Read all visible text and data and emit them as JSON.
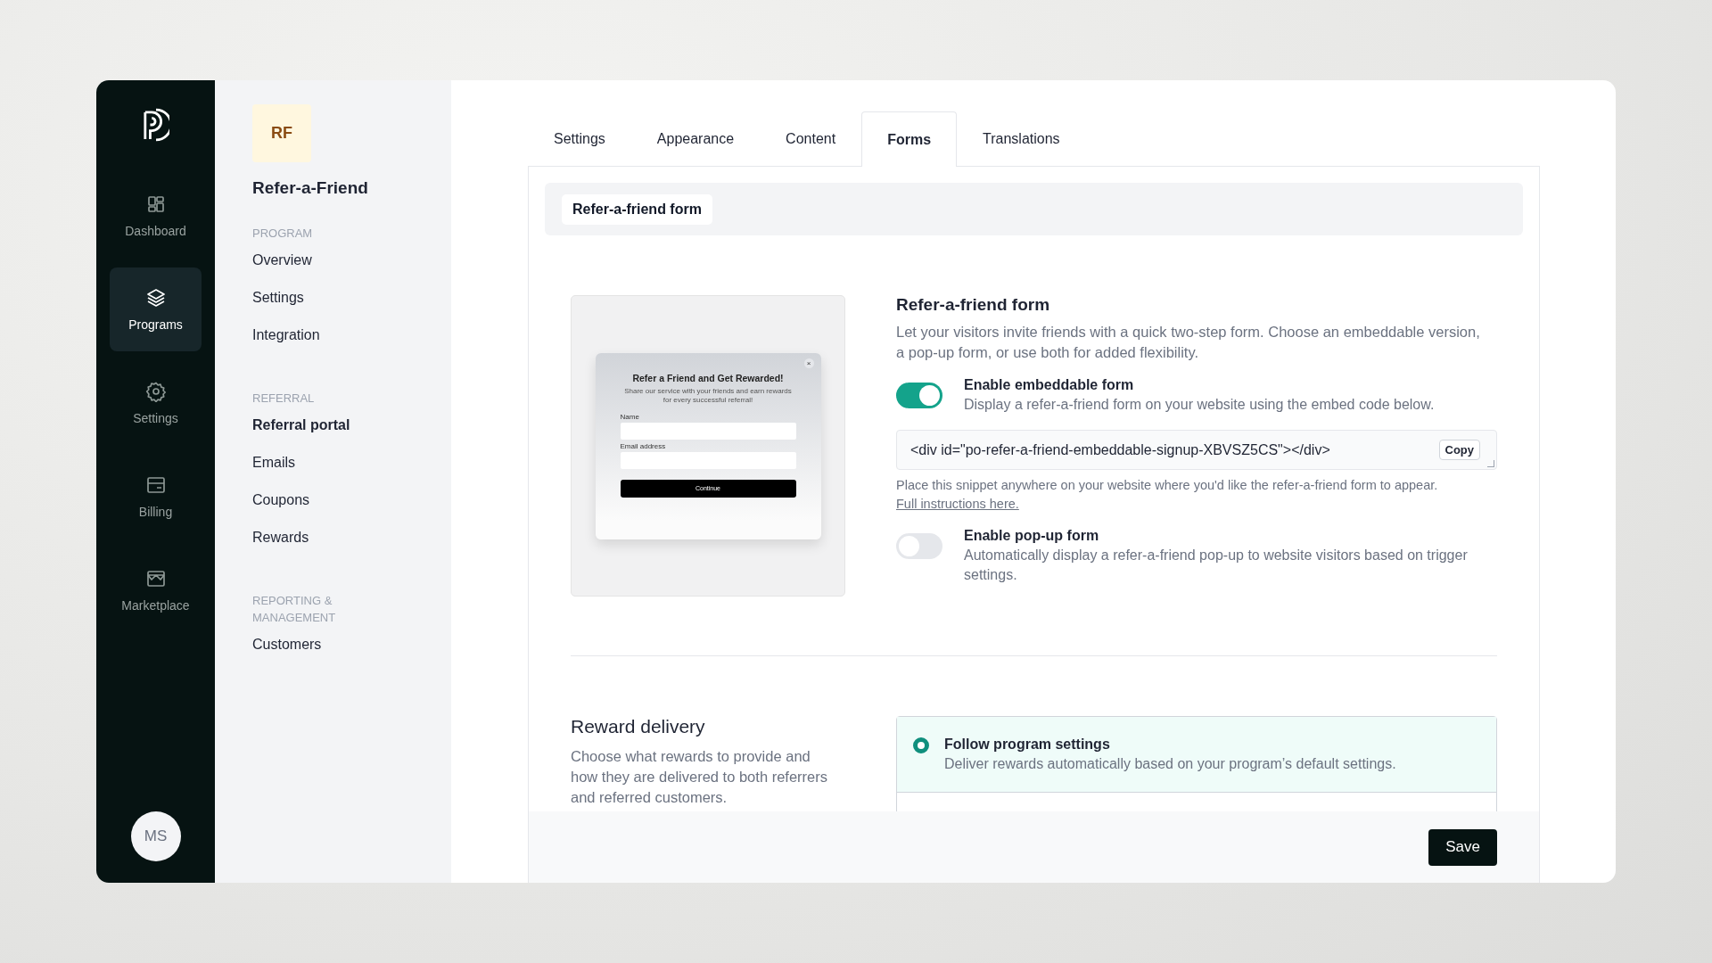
{
  "rail": {
    "items": [
      {
        "label": "Dashboard",
        "selected": false
      },
      {
        "label": "Programs",
        "selected": true
      },
      {
        "label": "Settings",
        "selected": false
      },
      {
        "label": "Billing",
        "selected": false
      },
      {
        "label": "Marketplace",
        "selected": false
      }
    ],
    "avatar": "MS"
  },
  "nav": {
    "badge": "RF",
    "title": "Refer-a-Friend",
    "sections": [
      {
        "heading": "PROGRAM",
        "items": [
          {
            "label": "Overview",
            "selected": false
          },
          {
            "label": "Settings",
            "selected": false
          },
          {
            "label": "Integration",
            "selected": false
          }
        ]
      },
      {
        "heading": "REFERRAL",
        "items": [
          {
            "label": "Referral portal",
            "selected": true
          },
          {
            "label": "Emails",
            "selected": false
          },
          {
            "label": "Coupons",
            "selected": false
          },
          {
            "label": "Rewards",
            "selected": false
          }
        ]
      },
      {
        "heading": "REPORTING & MANAGEMENT",
        "items": [
          {
            "label": "Customers",
            "selected": false
          }
        ]
      }
    ]
  },
  "tabs": [
    {
      "label": "Settings",
      "selected": false
    },
    {
      "label": "Appearance",
      "selected": false
    },
    {
      "label": "Content",
      "selected": false
    },
    {
      "label": "Forms",
      "selected": true
    },
    {
      "label": "Translations",
      "selected": false
    }
  ],
  "subtabs": [
    {
      "label": "Refer-a-friend form",
      "selected": true
    }
  ],
  "form_section": {
    "title": "Refer-a-friend form",
    "description": "Let your visitors invite friends with a quick two-step form. Choose an embeddable version, a pop-up form, or use both for added flexibility.",
    "preview": {
      "close": "×",
      "title": "Refer a Friend and Get Rewarded!",
      "subtitle": "Share our service with your friends and earn rewards for every successful referral!",
      "fields": [
        "Name",
        "Email address"
      ],
      "button": "Continue"
    },
    "settings": [
      {
        "kind": "toggle",
        "label": "Enable embeddable form",
        "description": "Display a refer-a-friend form on your website using the embed code below.",
        "on": true
      },
      {
        "kind": "snippet",
        "code": "<div id=\"po-refer-a-friend-embeddable-signup-XBVSZ5CS\"></div>",
        "button": "Copy",
        "note": "Place this snippet anywhere on your website where you'd like the refer-a-friend form to appear.",
        "link": "Full instructions here."
      },
      {
        "kind": "toggle",
        "label": "Enable pop-up form",
        "description": "Automatically display a refer-a-friend pop-up to website visitors based on trigger settings.",
        "on": false
      }
    ]
  },
  "reward_section": {
    "title": "Reward delivery",
    "description": "Choose what rewards to provide and how they are delivered to both referrers and referred customers.",
    "options": [
      {
        "label": "Follow program settings",
        "description": "Deliver rewards automatically based on your program’s default settings.",
        "selected": true
      }
    ]
  },
  "footer": {
    "save": "Save"
  }
}
